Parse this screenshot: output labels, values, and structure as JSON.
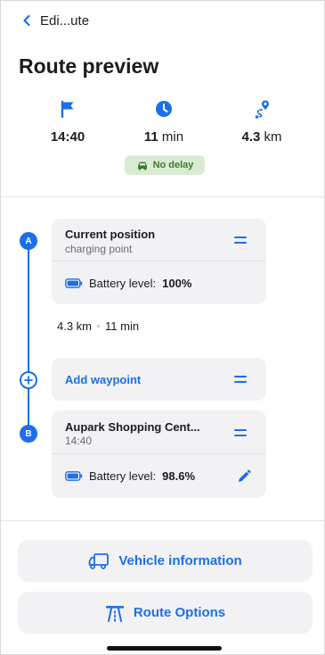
{
  "nav": {
    "back_label": "Edi...ute"
  },
  "page": {
    "title": "Route preview"
  },
  "stats": {
    "arrival_time": "14:40",
    "duration_value": "11",
    "duration_unit": "min",
    "distance_value": "4.3",
    "distance_unit": "km"
  },
  "delay_badge": {
    "label": "No delay"
  },
  "route": {
    "start": {
      "marker": "A",
      "title": "Current position",
      "subtitle": "charging point",
      "battery_label": "Battery level:",
      "battery_value": "100%"
    },
    "segment": {
      "distance": "4.3 km",
      "duration": "11 min"
    },
    "add_waypoint_label": "Add waypoint",
    "destination": {
      "marker": "B",
      "title": "Aupark Shopping Cent...",
      "subtitle": "14:40",
      "battery_label": "Battery level:",
      "battery_value": "98.6%"
    }
  },
  "buttons": {
    "vehicle_info": "Vehicle information",
    "route_options": "Route Options"
  },
  "icons": {
    "back": "chevron-left-icon",
    "arrival": "flag-icon",
    "duration": "clock-icon",
    "distance": "route-pin-icon",
    "delay": "car-icon",
    "battery": "battery-icon",
    "reorder": "drag-handle-icon",
    "add": "plus-circle-icon",
    "edit": "pencil-icon",
    "vehicle": "truck-icon",
    "options": "highway-icon"
  },
  "colors": {
    "accent": "#1c6fe8",
    "badge_bg": "#d9ecd3",
    "badge_text": "#3d7a2a",
    "card_bg": "#f2f2f5"
  }
}
